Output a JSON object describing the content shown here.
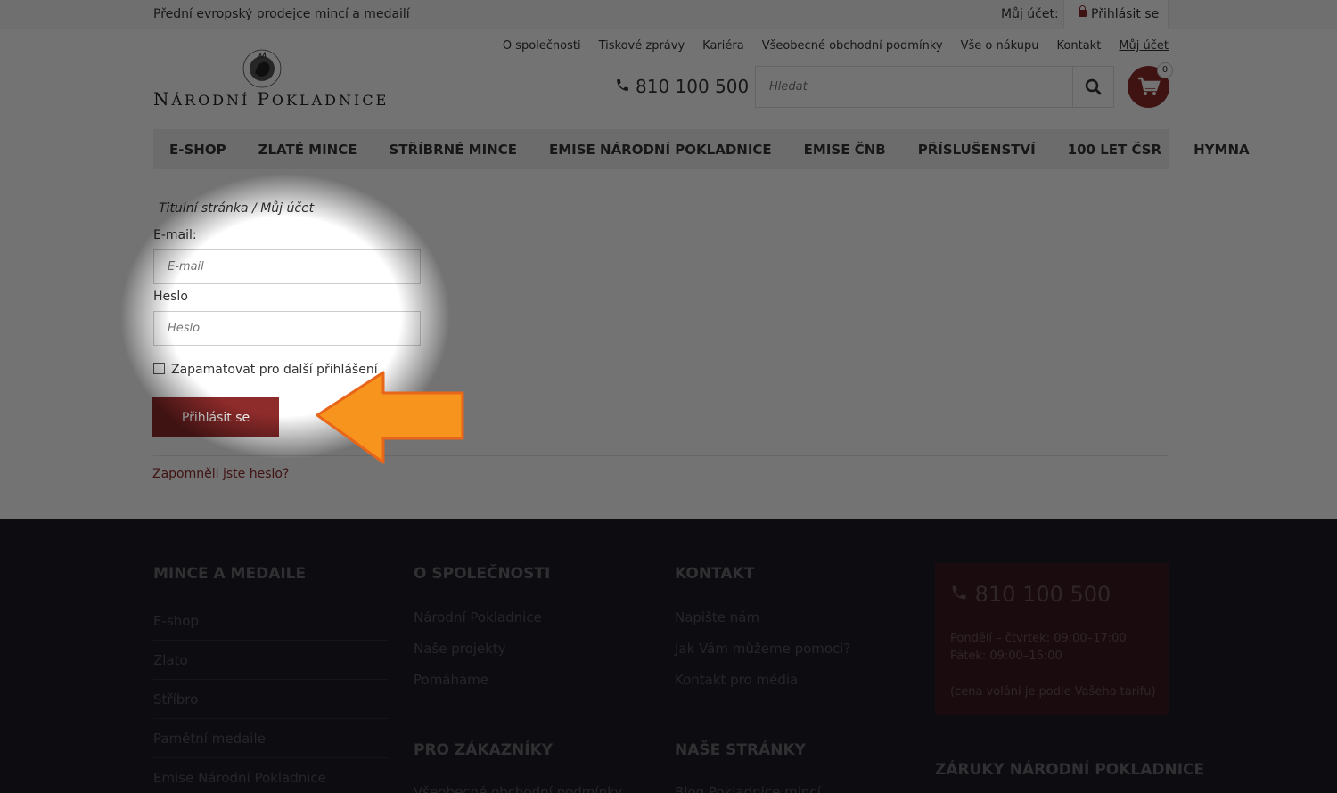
{
  "topbar": {
    "tagline": "Přední evropský prodejce mincí a medailí",
    "account_label": "Můj účet:",
    "login_link": "Přihlásit se"
  },
  "logo": {
    "n1": "N",
    "n2": "ÁRODNÍ ",
    "p1": "P",
    "p2": "OKLADNICE",
    "seal_text": "NÁRODNÍ POKLADNICE"
  },
  "top_links": [
    "O společnosti",
    "Tiskové zprávy",
    "Kariéra",
    "Všeobecné obchodní podmínky",
    "Vše o nákupu",
    "Kontakt",
    "Můj účet"
  ],
  "phone": "810 100 500",
  "search": {
    "placeholder": "Hledat"
  },
  "cart": {
    "count": "0"
  },
  "nav": [
    "E-SHOP",
    "ZLATÉ MINCE",
    "STŘÍBRNÉ MINCE",
    "EMISE NÁRODNÍ POKLADNICE",
    "EMISE ČNB",
    "PŘÍSLUŠENSTVÍ",
    "100 LET ČSR",
    "HYMNA"
  ],
  "breadcrumb": "Titulní stránka  /  Můj účet",
  "form": {
    "email_label": "E-mail:",
    "email_placeholder": "E-mail",
    "password_label": "Heslo",
    "password_placeholder": "Heslo",
    "remember_label": "Zapamatovat pro další přihlášení",
    "submit_label": "Přihlásit se",
    "forgot_link": "Zapomněli jste heslo?"
  },
  "footer": {
    "col1": {
      "title": "MINCE A MEDAILE",
      "items": [
        "E-shop",
        "Zlato",
        "Stříbro",
        "Pamětní medaile",
        "Emise Národní Pokladnice"
      ]
    },
    "col2": {
      "title": "O SPOLEČNOSTI",
      "items": [
        "Národní Pokladnice",
        "Naše projekty",
        "Pomáháme"
      ],
      "title2": "PRO ZÁKAZNÍKY",
      "items2": [
        "Všeobecné obchodní podmínky"
      ]
    },
    "col3": {
      "title": "KONTAKT",
      "items": [
        "Napište nám",
        "Jak Vám můžeme pomoci?",
        "Kontakt pro média"
      ],
      "title2": "NAŠE STRÁNKY",
      "items2": [
        "Blog Pokladnice mincí"
      ]
    },
    "contact": {
      "phone": "810 100 500",
      "hours1": "Pondělí – čtvrtek: 09:00–17:00",
      "hours2": "Pátek: 09:00–15:00",
      "note": "(cena volání je podle Vašeho tarifu)"
    },
    "col4_title": "ZÁRUKY NÁRODNÍ POKLADNICE"
  },
  "colors": {
    "accent": "#8e2b2b",
    "footer_bg": "#1d1d26",
    "arrow": "#f7941d"
  }
}
